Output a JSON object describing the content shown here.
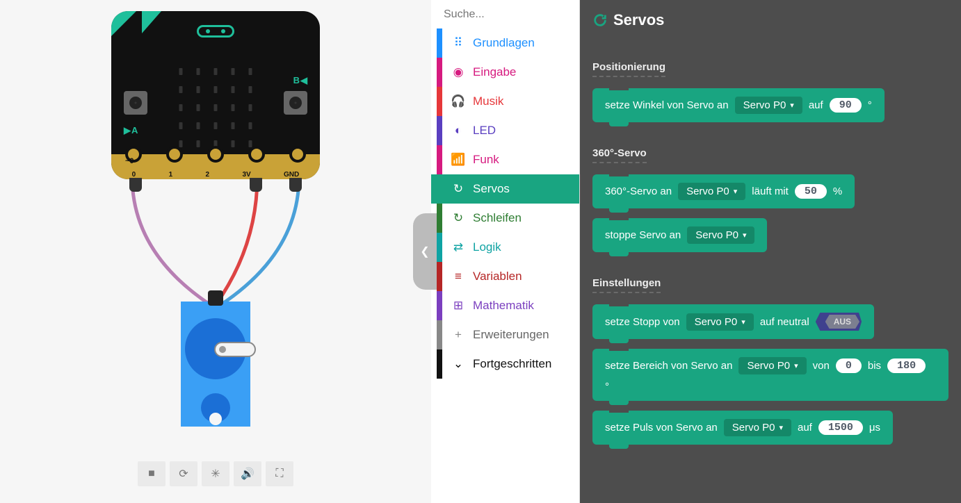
{
  "search": {
    "placeholder": "Suche..."
  },
  "categories": [
    {
      "stripe": "#1e90ff",
      "iconColor": "#1e90ff",
      "icon": "⠿",
      "label": "Grundlagen",
      "txt": "#1e90ff"
    },
    {
      "stripe": "#d61a7f",
      "iconColor": "#d61a7f",
      "icon": "◉",
      "label": "Eingabe",
      "txt": "#d61a7f"
    },
    {
      "stripe": "#e6373a",
      "iconColor": "#e6373a",
      "icon": "🎧",
      "label": "Musik",
      "txt": "#e6373a"
    },
    {
      "stripe": "#5a3fc0",
      "iconColor": "#5a3fc0",
      "icon": "◐",
      "label": "LED",
      "txt": "#5a3fc0"
    },
    {
      "stripe": "#d61a7f",
      "iconColor": "#d61a7f",
      "icon": "📶",
      "label": "Funk",
      "txt": "#d61a7f"
    },
    {
      "stripe": "#19A581",
      "iconColor": "#fff",
      "icon": "↻",
      "label": "Servos",
      "txt": "#fff",
      "active": true
    },
    {
      "stripe": "#2e7d32",
      "iconColor": "#2e7d32",
      "icon": "↻",
      "label": "Schleifen",
      "txt": "#2e7d32"
    },
    {
      "stripe": "#0fa3a3",
      "iconColor": "#0fa3a3",
      "icon": "⇄",
      "label": "Logik",
      "txt": "#0fa3a3"
    },
    {
      "stripe": "#b52626",
      "iconColor": "#b52626",
      "icon": "≡",
      "label": "Variablen",
      "txt": "#b52626"
    },
    {
      "stripe": "#7b3fbf",
      "iconColor": "#7b3fbf",
      "icon": "⊞",
      "label": "Mathematik",
      "txt": "#7b3fbf"
    },
    {
      "stripe": "#888",
      "iconColor": "#888",
      "icon": "+",
      "label": "Erweiterungen",
      "txt": "#666"
    },
    {
      "stripe": "#111",
      "iconColor": "#111",
      "icon": "⌄",
      "label": "Fortgeschritten",
      "txt": "#111"
    }
  ],
  "panel": {
    "title": "Servos",
    "s1": "Positionierung",
    "s2": "360°-Servo",
    "s3": "Einstellungen",
    "pin": "Servo P0",
    "b1a": "setze Winkel von Servo an",
    "b1b": "auf",
    "b1v": "90",
    "b1u": "°",
    "b2a": "360°-Servo an",
    "b2b": "läuft mit",
    "b2v": "50",
    "b2u": "%",
    "b3a": "stoppe Servo an",
    "b4a": "setze Stopp von",
    "b4b": "auf neutral",
    "b4t": "AUS",
    "b5a": "setze Bereich von Servo an",
    "b5b": "von",
    "b5v1": "0",
    "b5c": "bis",
    "b5v2": "180",
    "b5u": "°",
    "b6a": "setze Puls von Servo an",
    "b6b": "auf",
    "b6v": "1500",
    "b6u": "μs"
  },
  "pins": {
    "p0": "0",
    "p1": "1",
    "p2": "2",
    "p3v": "3V",
    "gnd": "GND",
    "ac": "~0"
  },
  "simtools": {
    "stop": "■",
    "refresh": "⟳",
    "bug": "✳",
    "sound": "🔊",
    "full": "⛶"
  }
}
